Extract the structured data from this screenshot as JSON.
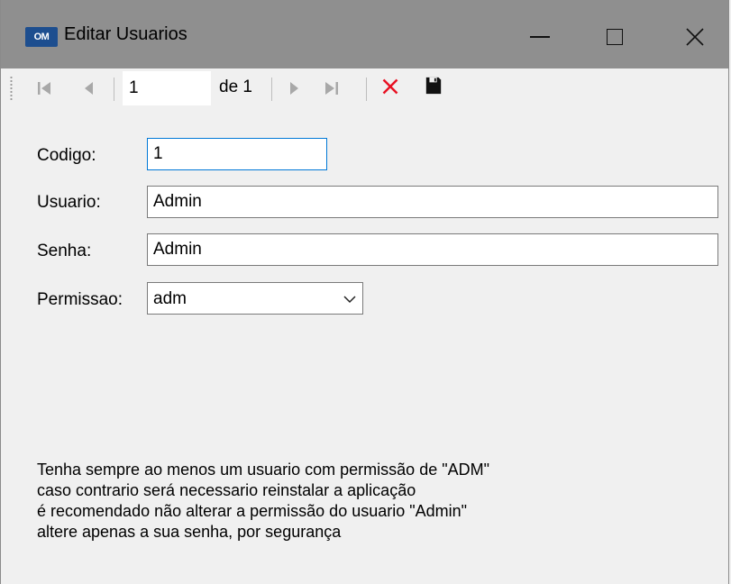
{
  "window": {
    "title": "Editar Usuarios",
    "app_icon_text": "OM"
  },
  "navigator": {
    "position": "1",
    "count_label": "de 1"
  },
  "form": {
    "codigo": {
      "label": "Codigo:",
      "value": "1"
    },
    "usuario": {
      "label": "Usuario:",
      "value": "Admin"
    },
    "senha": {
      "label": "Senha:",
      "value": "Admin"
    },
    "permissao": {
      "label": "Permissao:",
      "value": "adm"
    }
  },
  "note_lines": [
    "Tenha sempre ao menos um usuario com permissão de \"ADM\"",
    "caso contrario será necessario reinstalar a aplicação",
    "é recomendado não alterar a permissão do usuario \"Admin\"",
    "altere apenas a sua senha, por segurança"
  ],
  "colors": {
    "titlebar": "#8f8f8f",
    "focus_border": "#0078d7",
    "delete_red": "#e81123"
  }
}
